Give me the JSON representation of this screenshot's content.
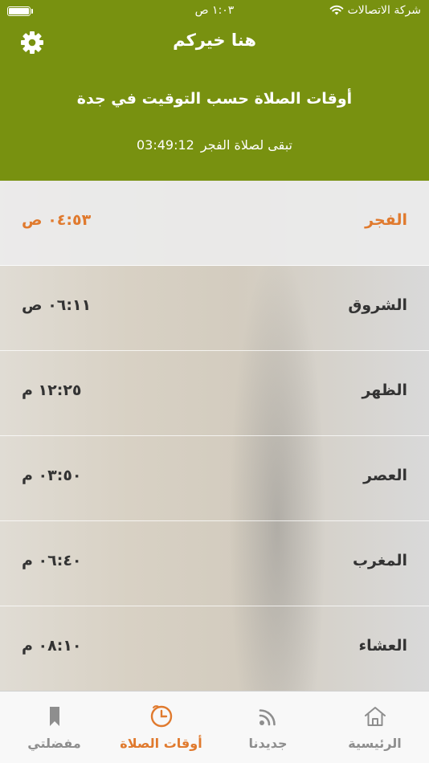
{
  "status_bar": {
    "carrier": "شركة الاتصالات",
    "time": "١:٠٣ ص"
  },
  "header": {
    "title": "هنا خيركم",
    "subtitle": "أوقات الصلاة حسب التوقيت في جدة",
    "countdown_label": "تبقى لصلاة الفجر",
    "countdown_time": "03:49:12",
    "settings_icon": "gear-icon"
  },
  "prayers": [
    {
      "name": "الفجر",
      "time": "٠٤:٥٣ ص",
      "active": true
    },
    {
      "name": "الشروق",
      "time": "٠٦:١١ ص",
      "active": false
    },
    {
      "name": "الظهر",
      "time": "١٢:٢٥ م",
      "active": false
    },
    {
      "name": "العصر",
      "time": "٠٣:٥٠ م",
      "active": false
    },
    {
      "name": "المغرب",
      "time": "٠٦:٤٠ م",
      "active": false
    },
    {
      "name": "العشاء",
      "time": "٠٨:١٠ م",
      "active": false
    }
  ],
  "tabs": [
    {
      "label": "الرئيسية",
      "icon": "home-icon"
    },
    {
      "label": "جديدنا",
      "icon": "rss-icon"
    },
    {
      "label": "أوقات الصلاة",
      "icon": "clock-icon",
      "active": true
    },
    {
      "label": "مفضلتي",
      "icon": "bookmark-icon"
    }
  ],
  "colors": {
    "header_bg": "#789110",
    "accent": "#e07a2e",
    "text_dark": "#333333",
    "tab_inactive": "#8e8e8e"
  }
}
